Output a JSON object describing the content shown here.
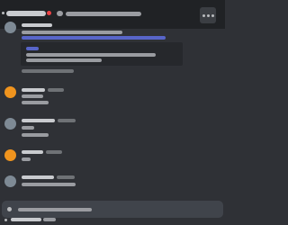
{
  "header": {
    "channel_icon": "hash-icon",
    "notification_dot_color": "#ed4245",
    "thread_icon": "threads-icon",
    "more_icon": "ellipsis-icon"
  },
  "messages": [
    {
      "avatar_color": "#7e8a95",
      "has_embed": true,
      "link_color": "#5865c9"
    },
    {
      "avatar_color": "#f0941e"
    },
    {
      "avatar_color": "#7e8a95"
    },
    {
      "avatar_color": "#f0941e"
    },
    {
      "avatar_color": "#7e8a95"
    }
  ],
  "composer": {
    "add_icon": "plus-circle-icon"
  },
  "colors": {
    "background": "#2f3136",
    "topbar": "#202225",
    "composer": "#40444b"
  }
}
